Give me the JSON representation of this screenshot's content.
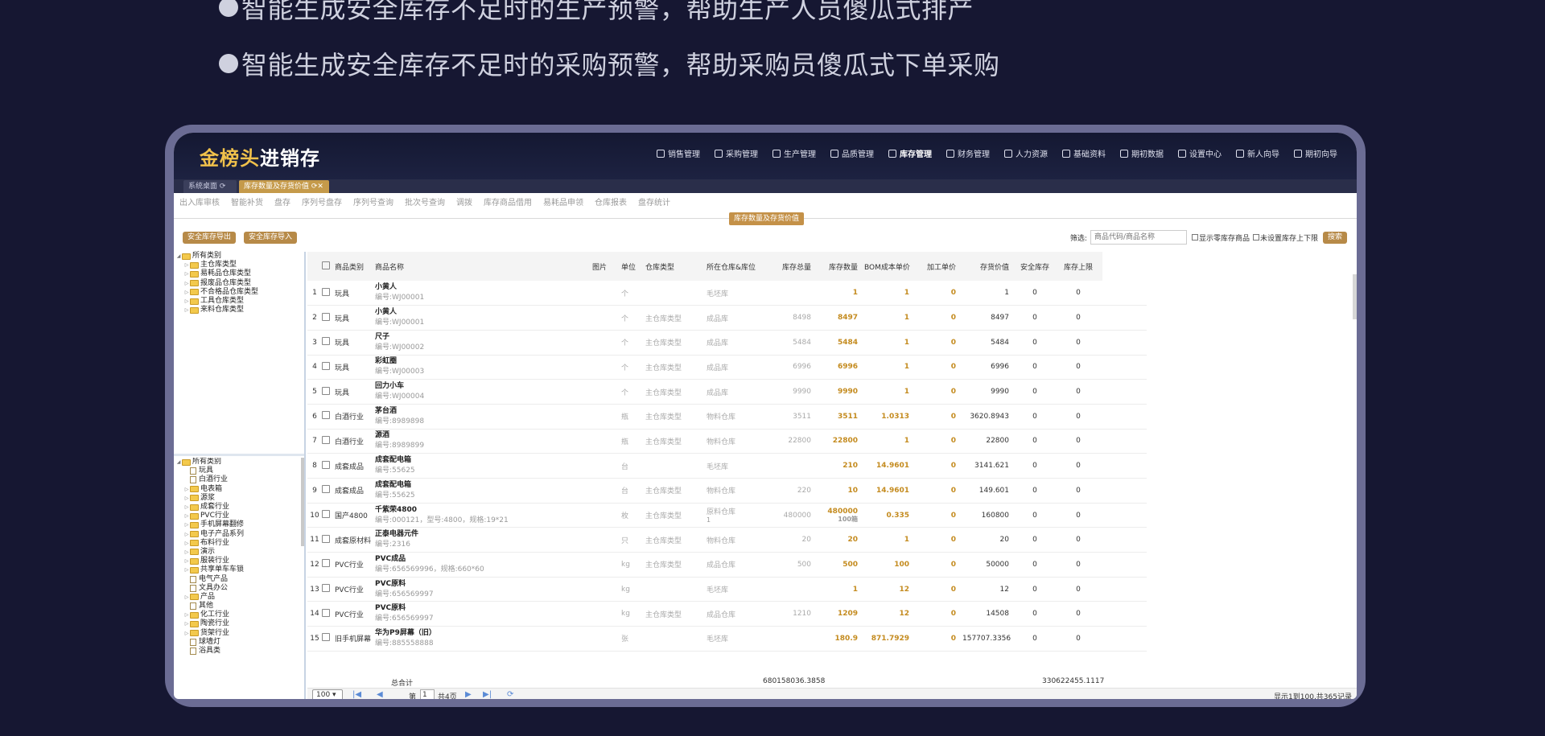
{
  "bullets": [
    "智能生成安全库存不足时的生产预警，帮助生产人员傻瓜式排产",
    "智能生成安全库存不足时的采购预警，帮助采购员傻瓜式下单采购"
  ],
  "app": {
    "logo_gold": "金榜头",
    "logo_white": "进销存"
  },
  "topnav": [
    "销售管理",
    "采购管理",
    "生产管理",
    "品质管理",
    "库存管理",
    "财务管理",
    "人力资源",
    "基础资料",
    "期初数据",
    "设置中心",
    "新人向导",
    "期初向导"
  ],
  "tabs": {
    "home": "系统桌面",
    "active": "库存数量及存货价值"
  },
  "subnav": [
    "出入库审核",
    "智能补货",
    "盘存",
    "序列号盘存",
    "序列号查询",
    "批次号查询",
    "调拨",
    "库存商品借用",
    "易耗品申领",
    "仓库报表",
    "盘存统计"
  ],
  "crumb": "库存数量及存货价值",
  "buttons": {
    "export": "安全库存导出",
    "import": "安全库存导入"
  },
  "filter": {
    "label": "筛选:",
    "placeholder": "商品代码/商品名称",
    "opt1": "显示零库存商品",
    "opt2": "未设置库存上下限",
    "search": "搜索"
  },
  "tree1": {
    "root": "所有类别",
    "items": [
      "主仓库类型",
      "易耗品仓库类型",
      "报废品仓库类型",
      "不合格品仓库类型",
      "工具仓库类型",
      "来料仓库类型"
    ]
  },
  "tree2": {
    "root": "所有类别",
    "items": [
      {
        "t": "d",
        "n": "玩具"
      },
      {
        "t": "d",
        "n": "白酒行业"
      },
      {
        "t": "f",
        "n": "电表箱"
      },
      {
        "t": "f",
        "n": "源浆"
      },
      {
        "t": "f",
        "n": "成套行业"
      },
      {
        "t": "f",
        "n": "PVC行业"
      },
      {
        "t": "f",
        "n": "手机屏幕翻修"
      },
      {
        "t": "f",
        "n": "电子产品系列"
      },
      {
        "t": "f",
        "n": "布料行业"
      },
      {
        "t": "f",
        "n": "演示"
      },
      {
        "t": "f",
        "n": "服装行业"
      },
      {
        "t": "f",
        "n": "共享单车车锁"
      },
      {
        "t": "d",
        "n": "电气产品"
      },
      {
        "t": "d",
        "n": "文具办公"
      },
      {
        "t": "f",
        "n": "产品"
      },
      {
        "t": "d",
        "n": "其他"
      },
      {
        "t": "f",
        "n": "化工行业"
      },
      {
        "t": "f",
        "n": "陶瓷行业"
      },
      {
        "t": "f",
        "n": "货架行业"
      },
      {
        "t": "d",
        "n": "球墙灯"
      },
      {
        "t": "d",
        "n": "浴具类"
      }
    ]
  },
  "columns": [
    "商品类别",
    "商品名称",
    "图片",
    "单位",
    "仓库类型",
    "所在仓库&库位",
    "库存总量",
    "库存数量",
    "BOM成本单价",
    "加工单价",
    "存货价值",
    "安全库存",
    "库存上限"
  ],
  "rows": [
    {
      "no": "1",
      "cat": "玩具",
      "name": "小黄人",
      "code": "编号:WJ00001",
      "unit": "个",
      "wtype": "",
      "wh": "毛坯库",
      "total": "",
      "qty": "1",
      "bom": "1",
      "proc": "0",
      "value": "1",
      "safe": "0",
      "max": "0"
    },
    {
      "no": "2",
      "cat": "玩具",
      "name": "小黄人",
      "code": "编号:WJ00001",
      "unit": "个",
      "wtype": "主仓库类型",
      "wh": "成品库",
      "total": "8498",
      "qty": "8497",
      "bom": "1",
      "proc": "0",
      "value": "8497",
      "safe": "0",
      "max": "0"
    },
    {
      "no": "3",
      "cat": "玩具",
      "name": "尺子",
      "code": "编号:WJ00002",
      "unit": "个",
      "wtype": "主仓库类型",
      "wh": "成品库",
      "total": "5484",
      "qty": "5484",
      "bom": "1",
      "proc": "0",
      "value": "5484",
      "safe": "0",
      "max": "0"
    },
    {
      "no": "4",
      "cat": "玩具",
      "name": "彩虹圈",
      "code": "编号:WJ00003",
      "unit": "个",
      "wtype": "主仓库类型",
      "wh": "成品库",
      "total": "6996",
      "qty": "6996",
      "bom": "1",
      "proc": "0",
      "value": "6996",
      "safe": "0",
      "max": "0"
    },
    {
      "no": "5",
      "cat": "玩具",
      "name": "回力小车",
      "code": "编号:WJ00004",
      "unit": "个",
      "wtype": "主仓库类型",
      "wh": "成品库",
      "total": "9990",
      "qty": "9990",
      "bom": "1",
      "proc": "0",
      "value": "9990",
      "safe": "0",
      "max": "0"
    },
    {
      "no": "6",
      "cat": "白酒行业",
      "name": "茅台酒",
      "code": "编号:8989898",
      "unit": "瓶",
      "wtype": "主仓库类型",
      "wh": "物料仓库",
      "total": "3511",
      "qty": "3511",
      "bom": "1.0313",
      "proc": "0",
      "value": "3620.8943",
      "safe": "0",
      "max": "0"
    },
    {
      "no": "7",
      "cat": "白酒行业",
      "name": "源酒",
      "code": "编号:8989899",
      "unit": "瓶",
      "wtype": "主仓库类型",
      "wh": "物料仓库",
      "total": "22800",
      "qty": "22800",
      "bom": "1",
      "proc": "0",
      "value": "22800",
      "safe": "0",
      "max": "0"
    },
    {
      "no": "8",
      "cat": "成套成品",
      "name": "成套配电箱",
      "code": "编号:55625",
      "unit": "台",
      "wtype": "",
      "wh": "毛坯库",
      "total": "",
      "qty": "210",
      "bom": "14.9601",
      "proc": "0",
      "value": "3141.621",
      "safe": "0",
      "max": "0"
    },
    {
      "no": "9",
      "cat": "成套成品",
      "name": "成套配电箱",
      "code": "编号:55625",
      "unit": "台",
      "wtype": "主仓库类型",
      "wh": "物料仓库",
      "total": "220",
      "qty": "10",
      "bom": "14.9601",
      "proc": "0",
      "value": "149.601",
      "safe": "0",
      "max": "0"
    },
    {
      "no": "10",
      "cat": "国产4800",
      "name": "千紫荣4800",
      "code": "编号:000121，型号:4800，规格:19*21",
      "unit": "枚",
      "wtype": "主仓库类型",
      "wh": "原料仓库",
      "wh2": "1",
      "total": "480000",
      "qty": "480000",
      "qty2": "100箱",
      "bom": "0.335",
      "proc": "0",
      "value": "160800",
      "safe": "0",
      "max": "0"
    },
    {
      "no": "11",
      "cat": "成套原材料",
      "name": "正泰电器元件",
      "code": "编号:2316",
      "unit": "只",
      "wtype": "主仓库类型",
      "wh": "物料仓库",
      "total": "20",
      "qty": "20",
      "bom": "1",
      "proc": "0",
      "value": "20",
      "safe": "0",
      "max": "0"
    },
    {
      "no": "12",
      "cat": "PVC行业",
      "name": "PVC成品",
      "code": "编号:656569996，规格:660*60",
      "unit": "kg",
      "wtype": "主仓库类型",
      "wh": "成品仓库",
      "total": "500",
      "qty": "500",
      "bom": "100",
      "proc": "0",
      "value": "50000",
      "safe": "0",
      "max": "0"
    },
    {
      "no": "13",
      "cat": "PVC行业",
      "name": "PVC原料",
      "code": "编号:656569997",
      "unit": "kg",
      "wtype": "",
      "wh": "毛坯库",
      "total": "",
      "qty": "1",
      "bom": "12",
      "proc": "0",
      "value": "12",
      "safe": "0",
      "max": "0"
    },
    {
      "no": "14",
      "cat": "PVC行业",
      "name": "PVC原料",
      "code": "编号:656569997",
      "unit": "kg",
      "wtype": "主仓库类型",
      "wh": "成品仓库",
      "total": "1210",
      "qty": "1209",
      "bom": "12",
      "proc": "0",
      "value": "14508",
      "safe": "0",
      "max": "0"
    },
    {
      "no": "15",
      "cat": "旧手机屏幕",
      "name": "华为P9屏幕（旧）",
      "code": "编号:885558888",
      "unit": "张",
      "wtype": "",
      "wh": "毛坯库",
      "total": "",
      "qty": "180.9",
      "bom": "871.7929",
      "proc": "0",
      "value": "157707.3356",
      "safe": "0",
      "max": "0"
    }
  ],
  "totals": {
    "label": "总合计",
    "qty": "680158036.3858",
    "value": "330622455.1117"
  },
  "pager": {
    "size": "100",
    "page_prefix": "第",
    "page": "1",
    "page_suffix": "共4页",
    "summary": "显示1到100,共365记录"
  }
}
